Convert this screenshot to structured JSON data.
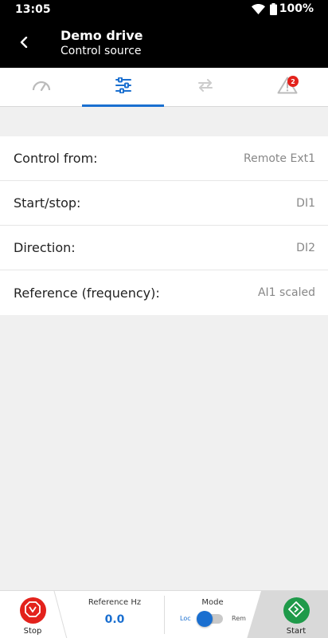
{
  "status_bar": {
    "time": "13:05",
    "battery": "100%",
    "icons": [
      "wifi-icon",
      "battery-icon"
    ]
  },
  "app_bar": {
    "back_icon": "back-arrow-icon",
    "title": "Demo drive",
    "subtitle": "Control source"
  },
  "tabs": [
    {
      "icon": "gauge-icon",
      "active": false
    },
    {
      "icon": "sliders-icon",
      "active": true
    },
    {
      "icon": "swap-arrows-icon",
      "active": false
    },
    {
      "icon": "warning-icon",
      "active": false,
      "badge": "2"
    }
  ],
  "settings": [
    {
      "label": "Control from:",
      "value": "Remote Ext1"
    },
    {
      "label": "Start/stop:",
      "value": "DI1"
    },
    {
      "label": "Direction:",
      "value": "DI2"
    },
    {
      "label": "Reference (frequency):",
      "value": "AI1 scaled"
    }
  ],
  "bottom_bar": {
    "stop_label": "Stop",
    "reference_label": "Reference Hz",
    "reference_value": "0.0",
    "mode_label": "Mode",
    "mode_loc": "Loc",
    "mode_rem": "Rem",
    "mode_selected": "Loc",
    "start_label": "Start"
  },
  "colors": {
    "accent": "#1a6fd0",
    "stop": "#e3221c",
    "start": "#1f9a4a",
    "badge": "#e3221c"
  }
}
